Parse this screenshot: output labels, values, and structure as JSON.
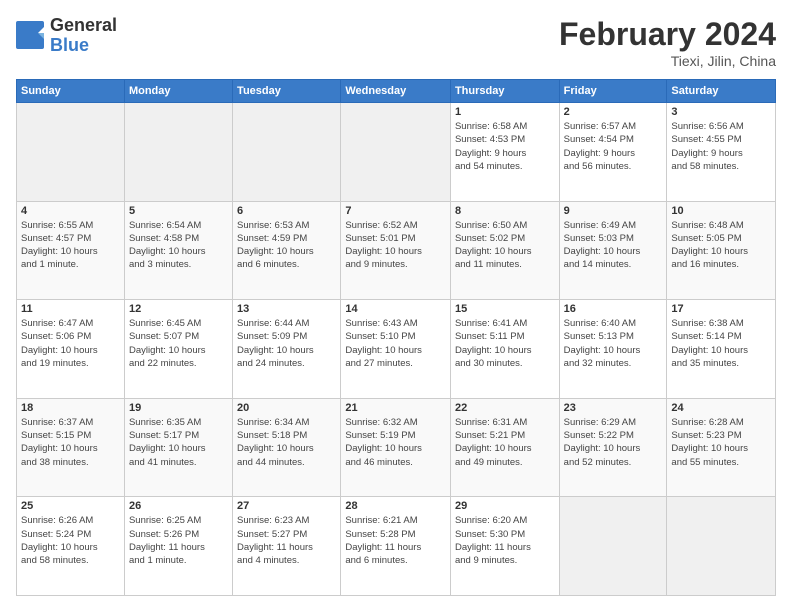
{
  "logo": {
    "line1": "General",
    "line2": "Blue"
  },
  "title": "February 2024",
  "subtitle": "Tiexi, Jilin, China",
  "days_header": [
    "Sunday",
    "Monday",
    "Tuesday",
    "Wednesday",
    "Thursday",
    "Friday",
    "Saturday"
  ],
  "weeks": [
    [
      {
        "day": "",
        "info": ""
      },
      {
        "day": "",
        "info": ""
      },
      {
        "day": "",
        "info": ""
      },
      {
        "day": "",
        "info": ""
      },
      {
        "day": "1",
        "info": "Sunrise: 6:58 AM\nSunset: 4:53 PM\nDaylight: 9 hours\nand 54 minutes."
      },
      {
        "day": "2",
        "info": "Sunrise: 6:57 AM\nSunset: 4:54 PM\nDaylight: 9 hours\nand 56 minutes."
      },
      {
        "day": "3",
        "info": "Sunrise: 6:56 AM\nSunset: 4:55 PM\nDaylight: 9 hours\nand 58 minutes."
      }
    ],
    [
      {
        "day": "4",
        "info": "Sunrise: 6:55 AM\nSunset: 4:57 PM\nDaylight: 10 hours\nand 1 minute."
      },
      {
        "day": "5",
        "info": "Sunrise: 6:54 AM\nSunset: 4:58 PM\nDaylight: 10 hours\nand 3 minutes."
      },
      {
        "day": "6",
        "info": "Sunrise: 6:53 AM\nSunset: 4:59 PM\nDaylight: 10 hours\nand 6 minutes."
      },
      {
        "day": "7",
        "info": "Sunrise: 6:52 AM\nSunset: 5:01 PM\nDaylight: 10 hours\nand 9 minutes."
      },
      {
        "day": "8",
        "info": "Sunrise: 6:50 AM\nSunset: 5:02 PM\nDaylight: 10 hours\nand 11 minutes."
      },
      {
        "day": "9",
        "info": "Sunrise: 6:49 AM\nSunset: 5:03 PM\nDaylight: 10 hours\nand 14 minutes."
      },
      {
        "day": "10",
        "info": "Sunrise: 6:48 AM\nSunset: 5:05 PM\nDaylight: 10 hours\nand 16 minutes."
      }
    ],
    [
      {
        "day": "11",
        "info": "Sunrise: 6:47 AM\nSunset: 5:06 PM\nDaylight: 10 hours\nand 19 minutes."
      },
      {
        "day": "12",
        "info": "Sunrise: 6:45 AM\nSunset: 5:07 PM\nDaylight: 10 hours\nand 22 minutes."
      },
      {
        "day": "13",
        "info": "Sunrise: 6:44 AM\nSunset: 5:09 PM\nDaylight: 10 hours\nand 24 minutes."
      },
      {
        "day": "14",
        "info": "Sunrise: 6:43 AM\nSunset: 5:10 PM\nDaylight: 10 hours\nand 27 minutes."
      },
      {
        "day": "15",
        "info": "Sunrise: 6:41 AM\nSunset: 5:11 PM\nDaylight: 10 hours\nand 30 minutes."
      },
      {
        "day": "16",
        "info": "Sunrise: 6:40 AM\nSunset: 5:13 PM\nDaylight: 10 hours\nand 32 minutes."
      },
      {
        "day": "17",
        "info": "Sunrise: 6:38 AM\nSunset: 5:14 PM\nDaylight: 10 hours\nand 35 minutes."
      }
    ],
    [
      {
        "day": "18",
        "info": "Sunrise: 6:37 AM\nSunset: 5:15 PM\nDaylight: 10 hours\nand 38 minutes."
      },
      {
        "day": "19",
        "info": "Sunrise: 6:35 AM\nSunset: 5:17 PM\nDaylight: 10 hours\nand 41 minutes."
      },
      {
        "day": "20",
        "info": "Sunrise: 6:34 AM\nSunset: 5:18 PM\nDaylight: 10 hours\nand 44 minutes."
      },
      {
        "day": "21",
        "info": "Sunrise: 6:32 AM\nSunset: 5:19 PM\nDaylight: 10 hours\nand 46 minutes."
      },
      {
        "day": "22",
        "info": "Sunrise: 6:31 AM\nSunset: 5:21 PM\nDaylight: 10 hours\nand 49 minutes."
      },
      {
        "day": "23",
        "info": "Sunrise: 6:29 AM\nSunset: 5:22 PM\nDaylight: 10 hours\nand 52 minutes."
      },
      {
        "day": "24",
        "info": "Sunrise: 6:28 AM\nSunset: 5:23 PM\nDaylight: 10 hours\nand 55 minutes."
      }
    ],
    [
      {
        "day": "25",
        "info": "Sunrise: 6:26 AM\nSunset: 5:24 PM\nDaylight: 10 hours\nand 58 minutes."
      },
      {
        "day": "26",
        "info": "Sunrise: 6:25 AM\nSunset: 5:26 PM\nDaylight: 11 hours\nand 1 minute."
      },
      {
        "day": "27",
        "info": "Sunrise: 6:23 AM\nSunset: 5:27 PM\nDaylight: 11 hours\nand 4 minutes."
      },
      {
        "day": "28",
        "info": "Sunrise: 6:21 AM\nSunset: 5:28 PM\nDaylight: 11 hours\nand 6 minutes."
      },
      {
        "day": "29",
        "info": "Sunrise: 6:20 AM\nSunset: 5:30 PM\nDaylight: 11 hours\nand 9 minutes."
      },
      {
        "day": "",
        "info": ""
      },
      {
        "day": "",
        "info": ""
      }
    ]
  ]
}
